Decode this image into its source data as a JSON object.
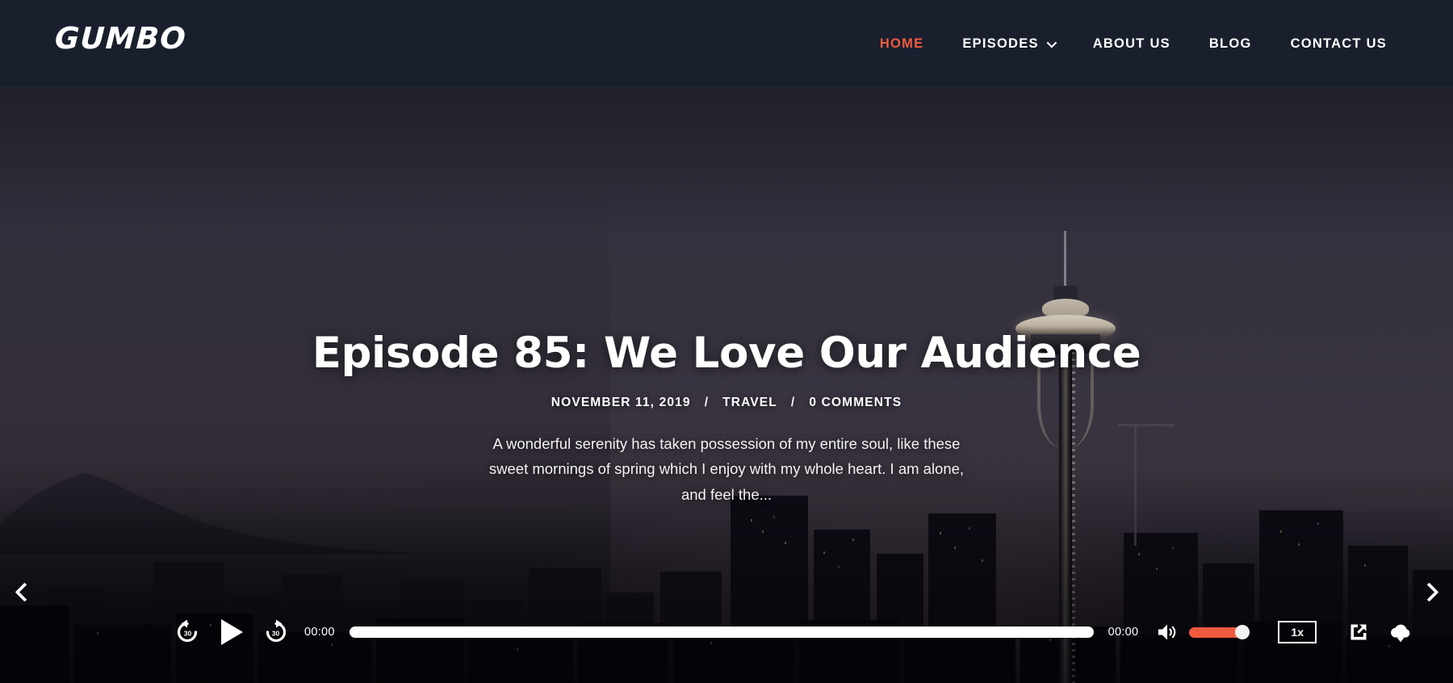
{
  "header": {
    "logo": "GUMBO",
    "nav": [
      {
        "label": "HOME",
        "active": true,
        "dropdown": false
      },
      {
        "label": "EPISODES",
        "active": false,
        "dropdown": true
      },
      {
        "label": "ABOUT US",
        "active": false,
        "dropdown": false
      },
      {
        "label": "BLOG",
        "active": false,
        "dropdown": false
      },
      {
        "label": "CONTACT US",
        "active": false,
        "dropdown": false
      }
    ],
    "accent_color": "#f05a3f",
    "background_color": "#1a1f2e"
  },
  "hero": {
    "title": "Episode 85: We Love Our Audience",
    "meta": {
      "date": "NOVEMBER 11, 2019",
      "separator": "/",
      "category": "TRAVEL",
      "comments": "0 COMMENTS"
    },
    "description": "A wonderful serenity has taken possession of my entire soul, like these sweet mornings of spring which I enjoy with my whole heart. I am alone, and feel the...",
    "prev_icon": "chevron-left-icon",
    "next_icon": "chevron-right-icon",
    "background_description": "night city skyline with space needle"
  },
  "player": {
    "rewind_icon": "rewind-30-icon",
    "rewind_label": "30",
    "play_icon": "play-icon",
    "forward_icon": "forward-30-icon",
    "forward_label": "30",
    "current_time": "00:00",
    "duration": "00:00",
    "progress_percent": 0,
    "volume_icon": "volume-high-icon",
    "volume_percent": 100,
    "volume_color": "#f05a3f",
    "speed_label": "1x",
    "share_icon": "external-link-icon",
    "download_icon": "cloud-download-icon"
  }
}
